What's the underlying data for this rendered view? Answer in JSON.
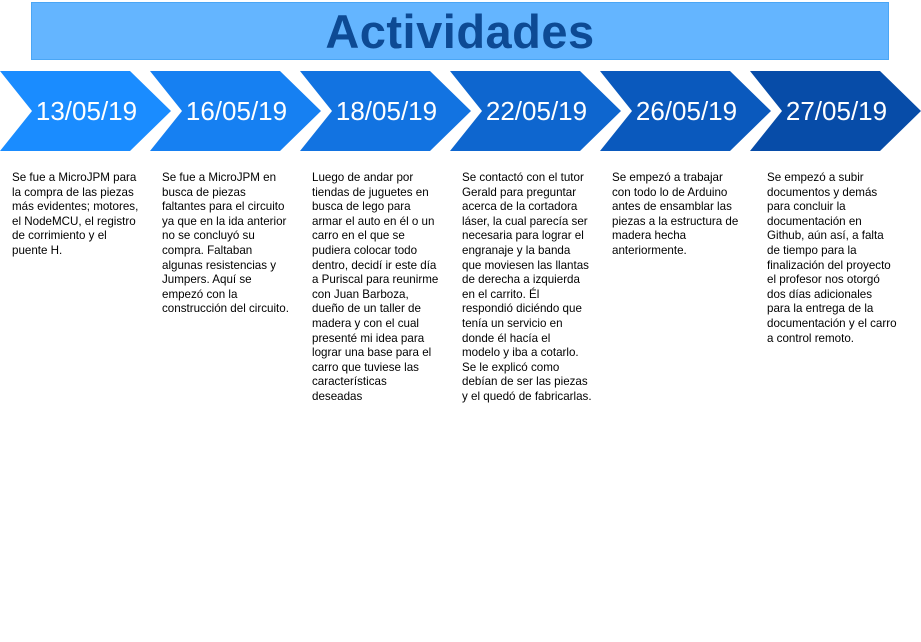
{
  "title": "Actividades",
  "colors": {
    "title_background": "#64b5ff",
    "title_text": "#0d4a94"
  },
  "timeline": [
    {
      "date": "13/05/19",
      "color": "#1a8cff",
      "description": "Se fue a MicroJPM para\nla compra de las piezas\nmás evidentes; motores,\nel NodeMCU, el registro\nde corrimiento y el\npuente H."
    },
    {
      "date": "16/05/19",
      "color": "#1680f2",
      "description": "Se fue a MicroJPM en\nbusca de piezas\nfaltantes para el circuito\nya que en la ida anterior\nno se concluyó su\ncompra. Faltaban\nalgunas resistencias y\nJumpers. Aquí se\nempezó con la\nconstrucción del circuito."
    },
    {
      "date": "18/05/19",
      "color": "#1273e1",
      "description": "Luego de andar por\ntiendas de juguetes en\nbusca de lego para\narmar el auto en él o un\ncarro en el que se\npudiera colocar todo\ndentro, decidí ir este día\na Puriscal para reunirme\ncon Juan Barboza,\ndueño de un taller de\nmadera y con el cual\npresenté mi idea para\nlograr una base para el\ncarro que tuviese las\ncaracterísticas\ndeseadas"
    },
    {
      "date": "22/05/19",
      "color": "#0e66cf",
      "description": "Se contactó con el tutor\nGerald para preguntar\nacerca de la cortadora\nláser, la cual parecía ser\nnecesaria para lograr el\nengranaje y la banda\nque moviesen las llantas\nde derecha a izquierda\nen el carrito. Él\nrespondió diciéndo que\ntenía un servicio en\ndonde él hacía el\nmodelo y iba a cotarlo.\nSe le explicó como\ndebían de ser las piezas\ny el quedó de fabricarlas."
    },
    {
      "date": "26/05/19",
      "color": "#0a59bd",
      "description": "Se empezó a trabajar\ncon todo lo de Arduino\nantes de ensamblar las\npiezas a la estructura de\nmadera hecha\nanteriormente."
    },
    {
      "date": "27/05/19",
      "color": "#074ca8",
      "description": "Se empezó a subir\ndocumentos y demás\npara concluir la\ndocumentación en\nGithub, aún así, a falta\nde tiempo para la\nfinalización del proyecto\nel profesor nos otorgó\ndos días adicionales\npara la entrega de la\ndocumentación y el carro\na control remoto."
    }
  ]
}
